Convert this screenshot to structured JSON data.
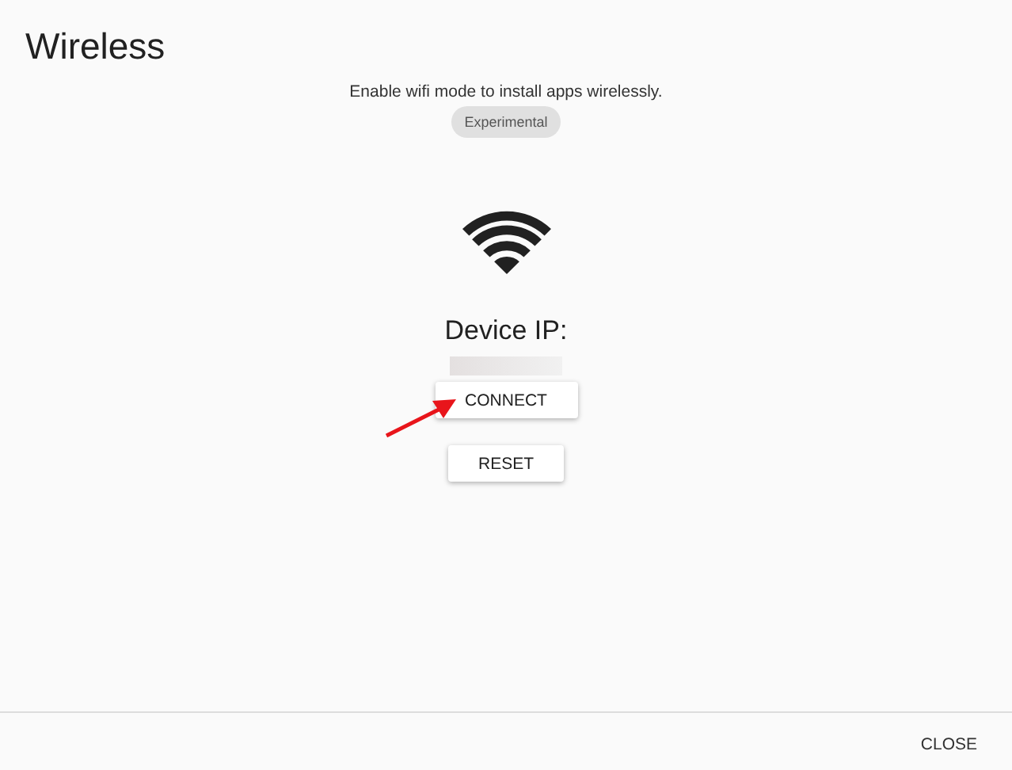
{
  "dialog": {
    "title": "Wireless",
    "description": "Enable wifi mode to install apps wirelessly.",
    "badge": "Experimental",
    "ip_label": "Device IP:",
    "buttons": [
      {
        "label": "CONNECT"
      },
      {
        "label": "RESET"
      }
    ],
    "footer_buttons": [
      "CLOSE"
    ]
  }
}
